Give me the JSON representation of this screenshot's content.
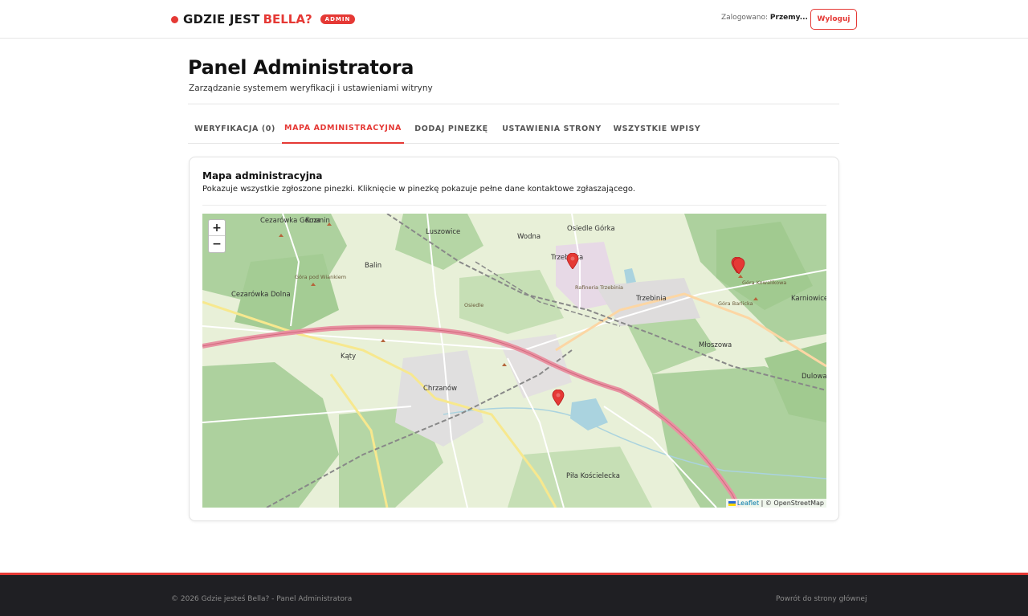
{
  "header": {
    "brand_text": "GDZIE JEST",
    "brand_accent": "BELLA?",
    "badge": "ADMIN",
    "logged_label": "Zalogowano:",
    "logged_user": "Przemy...",
    "logout_label": "Wyloguj"
  },
  "page": {
    "title": "Panel Administratora",
    "subtitle": "Zarządzanie systemem weryfikacji i ustawieniami witryny"
  },
  "tabs": [
    {
      "label": "WERYFIKACJA (0)",
      "active": false
    },
    {
      "label": "MAPA ADMINISTRACYJNA",
      "active": true
    },
    {
      "label": "DODAJ PINEZKĘ",
      "active": false
    },
    {
      "label": "USTAWIENIA STRONY",
      "active": false
    },
    {
      "label": "WSZYSTKIE WPISY",
      "active": false
    }
  ],
  "card": {
    "title": "Mapa administracyjna",
    "description": "Pokazuje wszystkie zgłoszone pinezki. Kliknięcie w pinezkę pokazuje pełne dane kontaktowe zgłaszającego."
  },
  "map": {
    "zoom_in": "+",
    "zoom_out": "−",
    "attribution_leaflet": "Leaflet",
    "attribution_sep": "|",
    "attribution_osm": "© OpenStreetMap",
    "pin_count": 4,
    "labels": {
      "l1": "Cezarówka Górna",
      "l2": "Kozmin",
      "l3": "Luszowice",
      "l4": "Wodna",
      "l5": "Osiedle Górka",
      "l6": "Trzebinka",
      "l7": "Balin",
      "l8": "Cezarówka Dolna",
      "l9": "Trzebinia",
      "l10": "Karniowice",
      "l11": "Góra Kowalikowa",
      "l12": "Góra Barlicka",
      "l13": "Kąty",
      "l14": "Chrzanów",
      "l15": "Młoszowa",
      "l16": "Dulowa",
      "l17": "Piła Kościelecka",
      "l18": "Rafineria Trzebinia",
      "l19": "Osiedle",
      "l20": "Góra pod Wiankiem"
    }
  },
  "footer": {
    "left": "© 2026 Gdzie jesteś Bella? - Panel Administratora",
    "right": "Powrót do strony głównej"
  },
  "colors": {
    "accent": "#e53935",
    "footer_bg": "#1f1f23",
    "map_land": "#e8f0d8",
    "map_forest": "#add19e",
    "motorway": "#e892a2"
  }
}
